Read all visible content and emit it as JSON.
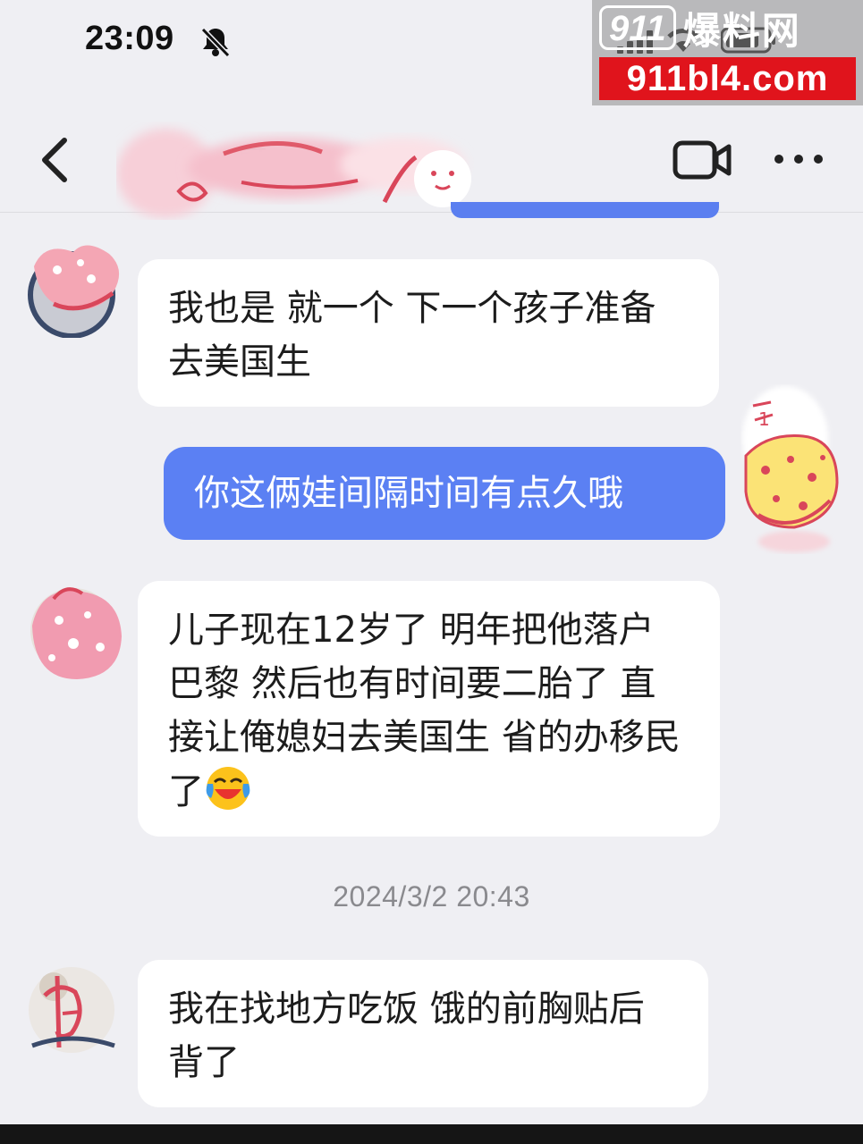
{
  "status_bar": {
    "time": "23:09"
  },
  "watermark": {
    "number_text": "911",
    "cn_text": "爆料网",
    "url": "911bl4.com"
  },
  "nav": {
    "title_visible_fragment": "哥"
  },
  "messages": [
    {
      "side": "in",
      "text": "我也是 就一个 下一个孩子准备去美国生"
    },
    {
      "side": "out",
      "text": "你这俩娃间隔时间有点久哦"
    },
    {
      "side": "in",
      "text": "儿子现在12岁了 明年把他落户巴黎 然后也有时间要二胎了 直接让俺媳妇去美国生 省的办移民了",
      "emoji": "laughing-crying-emoji"
    },
    {
      "side": "in",
      "text": "我在找地方吃饭 饿的前胸贴后背了"
    }
  ],
  "timestamp": "2024/3/2 20:43",
  "colors": {
    "outgoing_bubble": "#5b80f3",
    "incoming_bubble": "#ffffff",
    "background": "#efeff3",
    "watermark_red": "#e0141c"
  }
}
